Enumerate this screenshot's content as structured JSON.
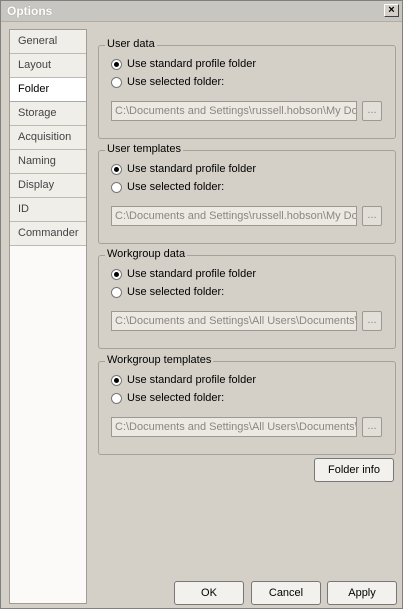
{
  "window": {
    "title": "Options",
    "close_label": "×"
  },
  "sidebar": {
    "items": [
      {
        "label": "General"
      },
      {
        "label": "Layout"
      },
      {
        "label": "Folder",
        "selected": true
      },
      {
        "label": "Storage"
      },
      {
        "label": "Acquisition"
      },
      {
        "label": "Naming"
      },
      {
        "label": "Display"
      },
      {
        "label": "ID"
      },
      {
        "label": "Commander"
      }
    ]
  },
  "groups": [
    {
      "title": "User data",
      "option_standard": "Use standard profile folder",
      "option_selected": "Use selected folder:",
      "path": "C:\\Documents and Settings\\russell.hobson\\My Docu",
      "browse": "..."
    },
    {
      "title": "User templates",
      "option_standard": "Use standard profile folder",
      "option_selected": "Use selected folder:",
      "path": "C:\\Documents and Settings\\russell.hobson\\My Docu",
      "browse": "..."
    },
    {
      "title": "Workgroup data",
      "option_standard": "Use standard profile folder",
      "option_selected": "Use selected folder:",
      "path": "C:\\Documents and Settings\\All Users\\Documents\\C:",
      "browse": "..."
    },
    {
      "title": "Workgroup templates",
      "option_standard": "Use standard profile folder",
      "option_selected": "Use selected folder:",
      "path": "C:\\Documents and Settings\\All Users\\Documents\\C:",
      "browse": "..."
    }
  ],
  "buttons": {
    "folder_info": "Folder info",
    "ok": "OK",
    "cancel": "Cancel",
    "apply": "Apply"
  }
}
